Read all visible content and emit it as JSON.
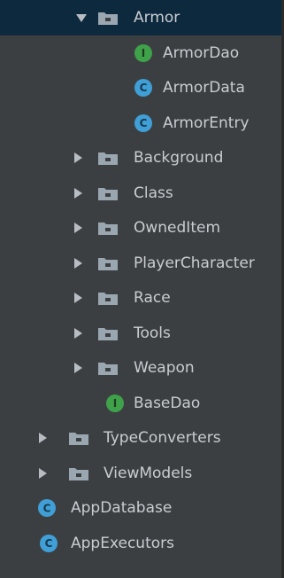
{
  "tree": {
    "armor": {
      "label": "Armor",
      "expanded": true,
      "selected": true
    },
    "armor_children": [
      {
        "label": "ArmorDao",
        "kind": "interface",
        "badge": "I"
      },
      {
        "label": "ArmorData",
        "kind": "class",
        "badge": "C"
      },
      {
        "label": "ArmorEntry",
        "kind": "class",
        "badge": "C"
      }
    ],
    "packages": [
      {
        "label": "Background"
      },
      {
        "label": "Class"
      },
      {
        "label": "OwnedItem"
      },
      {
        "label": "PlayerCharacter"
      },
      {
        "label": "Race"
      },
      {
        "label": "Tools"
      },
      {
        "label": "Weapon"
      }
    ],
    "base_dao": {
      "label": "BaseDao",
      "kind": "interface",
      "badge": "I"
    },
    "top_packages": [
      {
        "label": "TypeConverters"
      },
      {
        "label": "ViewModels"
      }
    ],
    "app_database": {
      "label": "AppDatabase",
      "kind": "abstract-class",
      "badge": "C"
    },
    "app_executors": {
      "label": "AppExecutors",
      "kind": "class",
      "badge": "C"
    }
  },
  "colors": {
    "background": "#3c3f41",
    "selection": "#0d293e",
    "text": "#c9cdd1",
    "interface_badge": "#3fa14a",
    "class_badge": "#3f9fd6",
    "folder": "#9aa7b0"
  },
  "icons": {
    "expanded": "triangle-down-icon",
    "collapsed": "triangle-right-icon",
    "folder": "package-folder-icon",
    "interface": "interface-icon",
    "class": "class-icon",
    "abstract_class": "abstract-class-icon"
  }
}
